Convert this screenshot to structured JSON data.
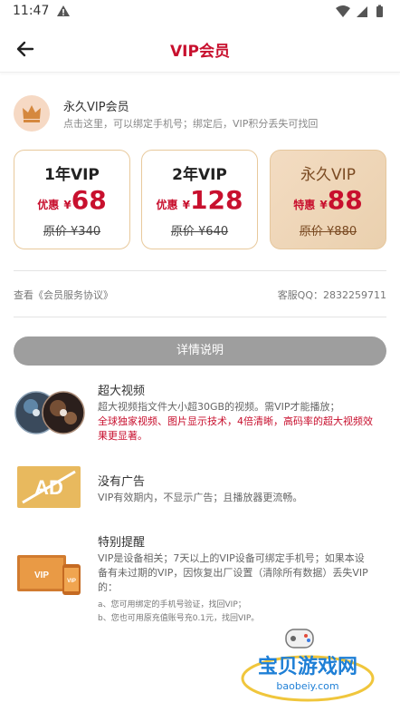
{
  "status": {
    "time": "11:47"
  },
  "header": {
    "title": "VIP会员"
  },
  "bind": {
    "title": "永久VIP会员",
    "description": "点击这里，可以绑定手机号；绑定后，VIP积分丢失可找回"
  },
  "plans": [
    {
      "name": "1年VIP",
      "tag": "优惠",
      "currency": "¥",
      "price": "68",
      "original": "原价 ¥340"
    },
    {
      "name": "2年VIP",
      "tag": "优惠",
      "currency": "¥",
      "price": "128",
      "original": "原价 ¥640"
    },
    {
      "name": "永久VIP",
      "tag": "特惠",
      "currency": "¥",
      "price": "88",
      "original": "原价 ¥880"
    }
  ],
  "agreement": "查看《会员服务协议》",
  "qq": "客服QQ：2832259711",
  "detail_button": "详情说明",
  "features": {
    "video": {
      "title": "超大视频",
      "line1": "超大视频指文件大小超30GB的视频。需VIP才能播放；",
      "line2": "全球独家视频、图片显示技术，4倍清晰，高码率的超大视频效",
      "line3": "果更显著。"
    },
    "ads": {
      "title": "没有广告",
      "text": "VIP有效期内，不显示广告；且播放器更流畅。",
      "icon_text": "AD"
    },
    "notice": {
      "title": "特别提醒",
      "line1": "VIP是设备相关；7天以上的VIP设备可绑定手机号；如果本设",
      "line2": "备有未过期的VIP，因恢复出厂设置（清除所有数据）丢失VIP",
      "line3": "的：",
      "sub1": "a、您可用绑定的手机号验证，找回VIP；",
      "sub2": "b、您也可用原充值账号充0.1元，找回VIP。",
      "icon_text1": "VIP",
      "icon_text2": "VIP"
    }
  },
  "watermark": {
    "title": "宝贝游戏网",
    "url": "baobeiy.com"
  },
  "colors": {
    "brand": "#c8102e",
    "gold": "#e8c99c",
    "button": "#9e9e9e"
  }
}
